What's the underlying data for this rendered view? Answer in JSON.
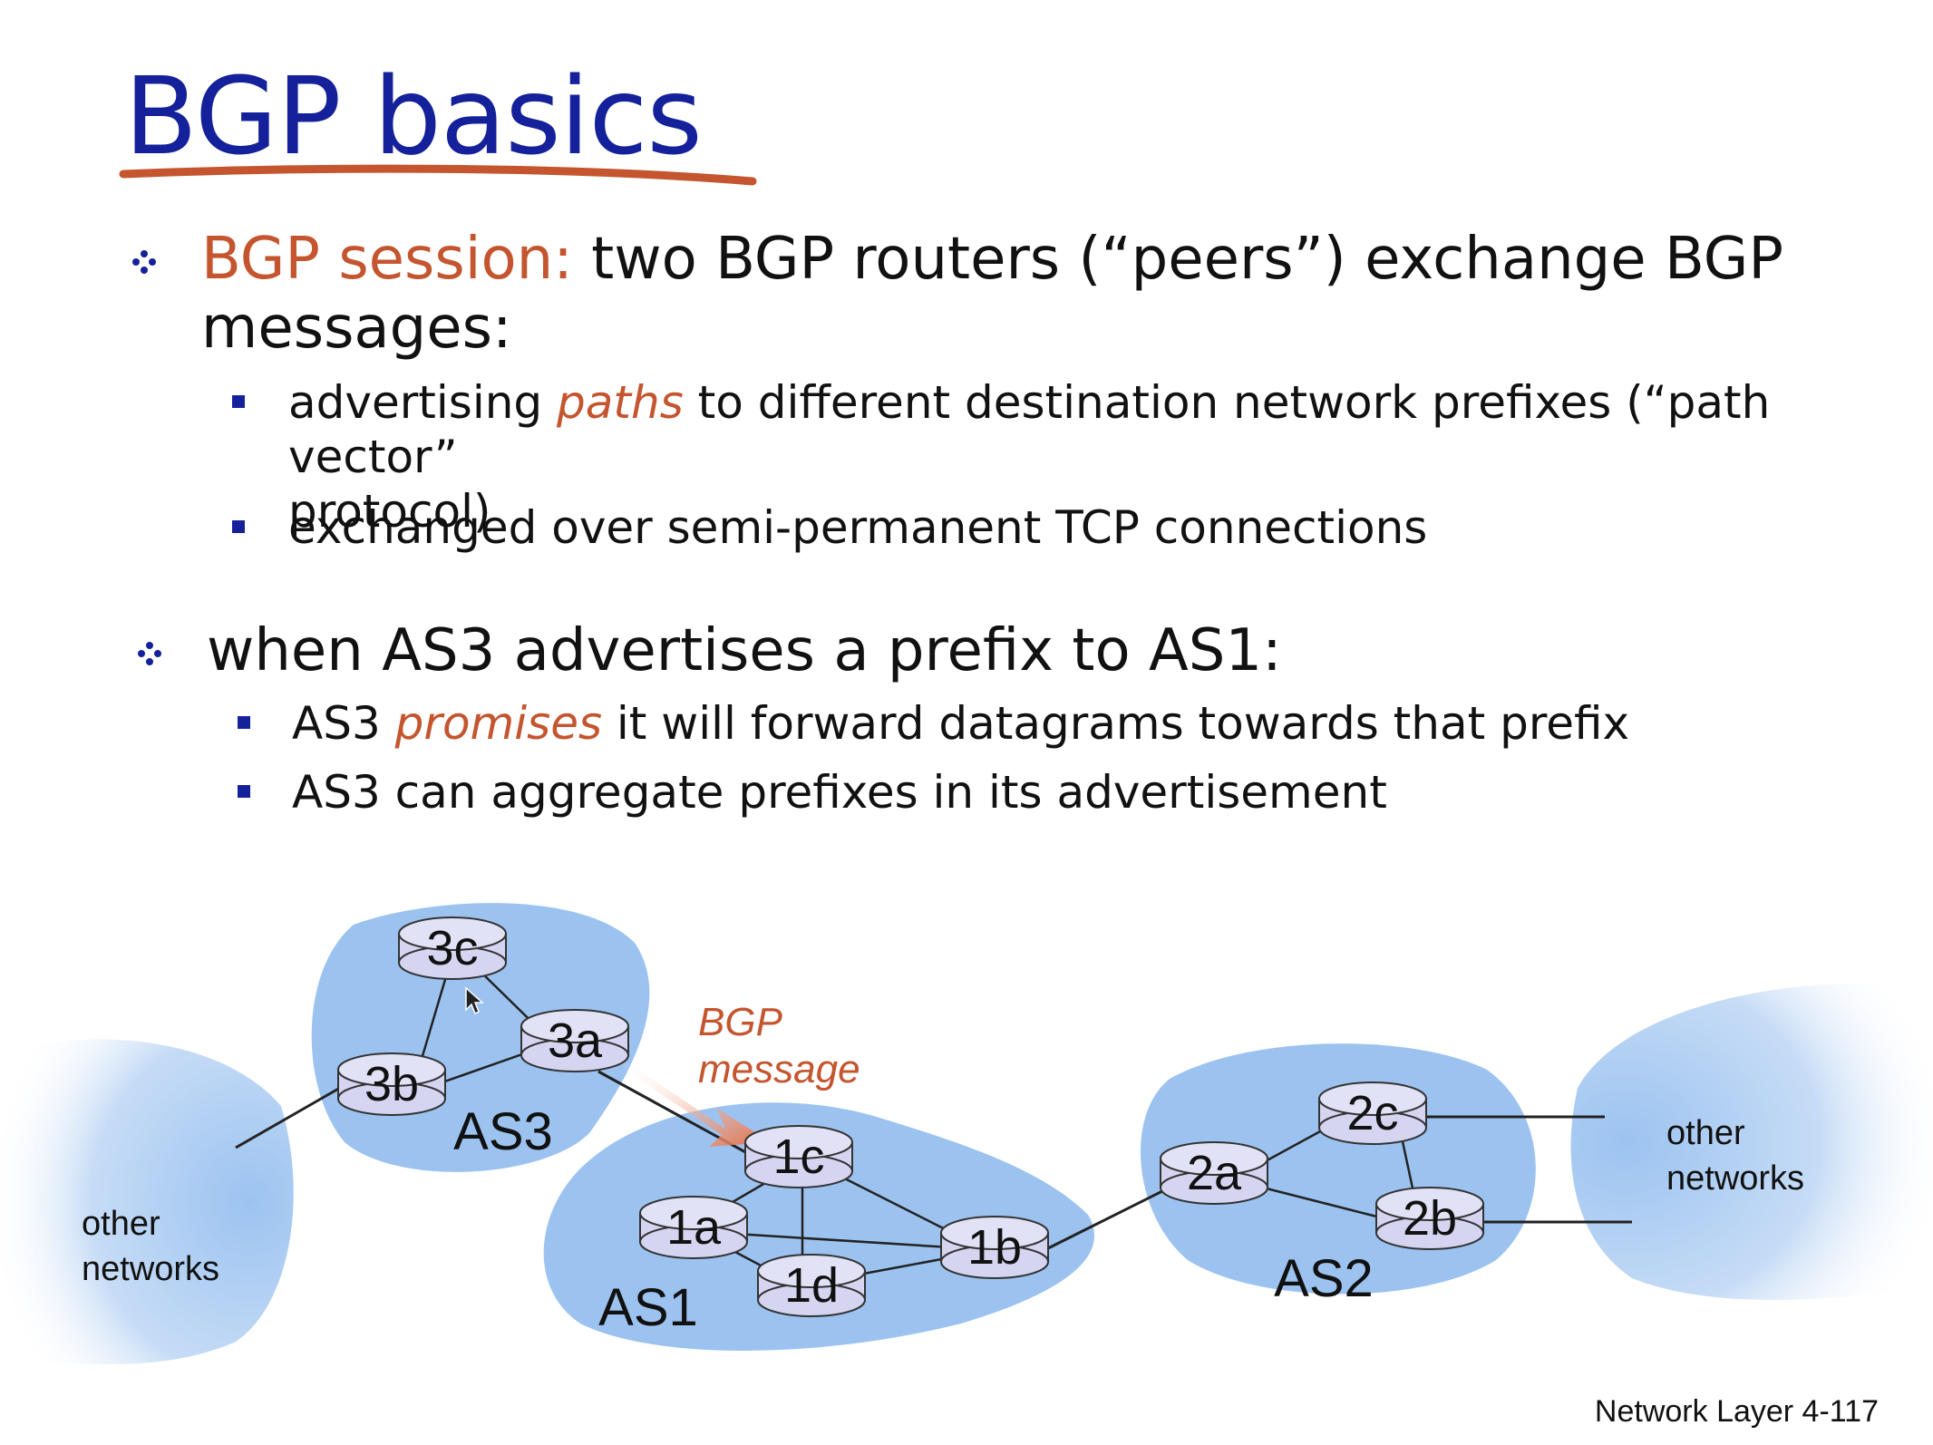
{
  "slide": {
    "title": "BGP basics",
    "bullets": [
      {
        "term": "BGP session:",
        "text_line1": "two BGP routers (“peers”) exchange BGP",
        "text_line2": "messages:",
        "subs": [
          {
            "pre": "advertising ",
            "emph": "paths",
            "post": " to different destination network prefixes (“path vector”",
            "line2": "protocol)"
          },
          {
            "pre": "exchanged over semi-permanent TCP connections",
            "emph": "",
            "post": "",
            "line2": ""
          }
        ]
      },
      {
        "text_line1": "when AS3 advertises a prefix to AS1:",
        "subs": [
          {
            "pre": "AS3 ",
            "emph": "promises",
            "post": " it will forward datagrams towards that prefix"
          },
          {
            "pre": "AS3 can aggregate prefixes in its advertisement",
            "emph": "",
            "post": ""
          }
        ]
      }
    ],
    "footer": "Network Layer  4-117"
  },
  "diagram": {
    "message_label_1": "BGP",
    "message_label_2": "message",
    "as_labels": {
      "as1": "AS1",
      "as2": "AS2",
      "as3": "AS3"
    },
    "other_networks_left": [
      "other",
      "networks"
    ],
    "other_networks_right": [
      "other",
      "networks"
    ],
    "routers": {
      "r3c": "3c",
      "r3a": "3a",
      "r3b": "3b",
      "r1c": "1c",
      "r1a": "1a",
      "r1b": "1b",
      "r1d": "1d",
      "r2a": "2a",
      "r2b": "2b",
      "r2c": "2c"
    },
    "colors": {
      "title": "#14219a",
      "accent": "#c4552f",
      "cloud": "#9cc3f0",
      "router_fill": "#d5d5f2"
    }
  }
}
